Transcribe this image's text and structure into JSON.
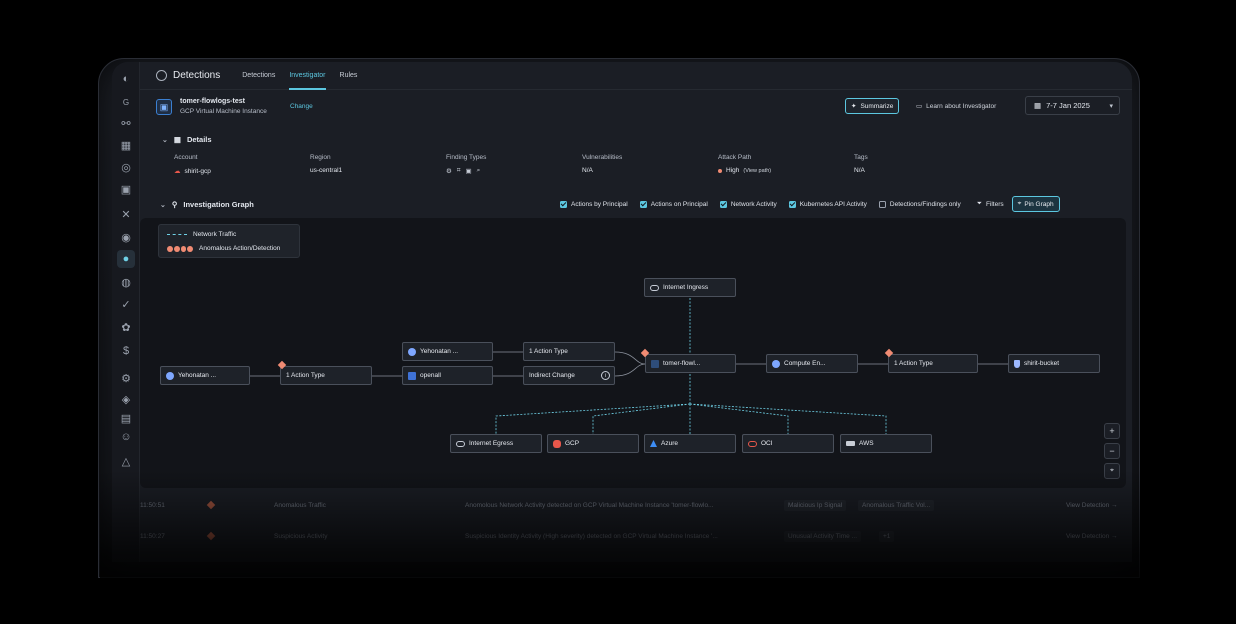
{
  "nav": {
    "brand": "Detections",
    "tabs": [
      {
        "label": "Detections",
        "active": false
      },
      {
        "label": "Investigator",
        "active": true
      },
      {
        "label": "Rules",
        "active": false
      }
    ]
  },
  "resource": {
    "name": "tomer-flowlogs-test",
    "type": "GCP Virtual Machine Instance",
    "change_label": "Change"
  },
  "header_actions": {
    "summarize": "Summarize",
    "learn": "Learn about Investigator",
    "date_range": "7-7 Jan 2025"
  },
  "details": {
    "title": "Details",
    "columns": [
      {
        "label": "Account",
        "value": "shirit-gcp"
      },
      {
        "label": "Region",
        "value": "us-central1"
      },
      {
        "label": "Finding Types",
        "value": ""
      },
      {
        "label": "Vulnerabilities",
        "value": "N/A"
      },
      {
        "label": "Attack Path",
        "value": "High",
        "extra": "(View path)"
      },
      {
        "label": "Tags",
        "value": "N/A"
      }
    ]
  },
  "graph": {
    "title": "Investigation Graph",
    "filters": [
      {
        "label": "Actions by Principal",
        "checked": true
      },
      {
        "label": "Actions on Principal",
        "checked": true
      },
      {
        "label": "Network Activity",
        "checked": true
      },
      {
        "label": "Kubernetes API Activity",
        "checked": true
      },
      {
        "label": "Detections/Findings only",
        "checked": false
      }
    ],
    "filters_label": "Filters",
    "pin_label": "Pin Graph",
    "legend": {
      "network": "Network Traffic",
      "anomalous": "Anomalous Action/Detection"
    },
    "nodes": {
      "yehonatan1": "Yehonatan ...",
      "action1": "1 Action Type",
      "yehonatan2": "Yehonatan ...",
      "openall": "openall",
      "action2": "1 Action Type",
      "indirect": "Indirect Change",
      "ingress": "Internet Ingress",
      "tomer": "tomer-flowl...",
      "compute": "Compute En...",
      "action3": "1 Action Type",
      "bucket": "shirit-bucket",
      "egress": "Internet Egress",
      "gcp": "GCP",
      "azure": "Azure",
      "oci": "OCI",
      "aws": "AWS"
    },
    "zoom": {
      "in": "+",
      "out": "−"
    }
  },
  "events": [
    {
      "time": "11:50:51",
      "type": "Anomalous Traffic",
      "description": "Anomolous Network Activity detected on GCP Virtual Machine Instance 'tomer-flowlo...",
      "tag1": "Malicious Ip Signal",
      "tag2": "Anomalous Traffic Vol...",
      "action": "View Detection →"
    },
    {
      "time": "11:50:27",
      "type": "Suspicious Activity",
      "description": "Suspicious Identity Activity (High severity) detected on GCP Virtual Machine Instance '...",
      "tag1": "Unusual Activity Time ...",
      "tag2": "+1",
      "action": "View Detection →"
    }
  ],
  "colors": {
    "accent": "#5cc7e0",
    "anomaly": "#f08b73",
    "background": "#1b1e25",
    "canvas": "#121419"
  }
}
